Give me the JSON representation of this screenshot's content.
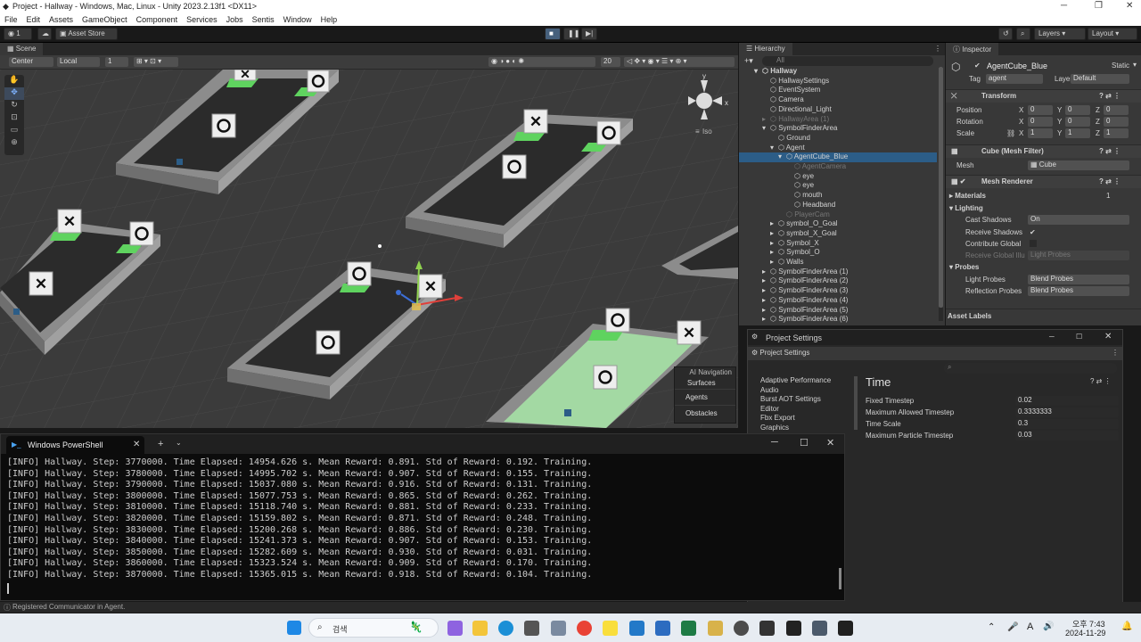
{
  "title": "Project - Hallway - Windows, Mac, Linux - Unity 2023.2.13f1 <DX11>",
  "menu": [
    "File",
    "Edit",
    "Assets",
    "GameObject",
    "Component",
    "Services",
    "Jobs",
    "Sentis",
    "Window",
    "Help"
  ],
  "toolbar": {
    "account": "1",
    "asset_store": "Asset Store",
    "layers": "Layers",
    "layout": "Layout"
  },
  "scene": {
    "tab": "Scene",
    "pivot": "Center",
    "space": "Local",
    "snap": "1",
    "zoom": "20",
    "iso": "Iso",
    "ai_nav": {
      "title": "AI Navigation",
      "items": [
        "Surfaces",
        "Agents",
        "Obstacles"
      ]
    }
  },
  "hierarchy": {
    "tab": "Hierarchy",
    "search": "All",
    "items": [
      {
        "label": "Hallway",
        "d": 0,
        "bold": true,
        "fold": "v"
      },
      {
        "label": "HallwaySettings",
        "d": 1
      },
      {
        "label": "EventSystem",
        "d": 1
      },
      {
        "label": "Camera",
        "d": 1
      },
      {
        "label": "Directional_Light",
        "d": 1
      },
      {
        "label": "HallwayArea (1)",
        "d": 1,
        "dim": true,
        "fold": ">"
      },
      {
        "label": "SymbolFinderArea",
        "d": 1,
        "fold": "v"
      },
      {
        "label": "Ground",
        "d": 2
      },
      {
        "label": "Agent",
        "d": 2,
        "fold": "v"
      },
      {
        "label": "AgentCube_Blue",
        "d": 3,
        "sel": true,
        "fold": "v"
      },
      {
        "label": "AgentCamera",
        "d": 4,
        "dim": true
      },
      {
        "label": "eye",
        "d": 4
      },
      {
        "label": "eye",
        "d": 4
      },
      {
        "label": "mouth",
        "d": 4
      },
      {
        "label": "Headband",
        "d": 4
      },
      {
        "label": "PlayerCam",
        "d": 3,
        "dim": true
      },
      {
        "label": "symbol_O_Goal",
        "d": 2,
        "fold": ">"
      },
      {
        "label": "symbol_X_Goal",
        "d": 2,
        "fold": ">"
      },
      {
        "label": "Symbol_X",
        "d": 2,
        "fold": ">"
      },
      {
        "label": "Symbol_O",
        "d": 2,
        "fold": ">"
      },
      {
        "label": "Walls",
        "d": 2,
        "fold": ">"
      },
      {
        "label": "SymbolFinderArea (1)",
        "d": 1,
        "fold": ">"
      },
      {
        "label": "SymbolFinderArea (2)",
        "d": 1,
        "fold": ">"
      },
      {
        "label": "SymbolFinderArea (3)",
        "d": 1,
        "fold": ">"
      },
      {
        "label": "SymbolFinderArea (4)",
        "d": 1,
        "fold": ">"
      },
      {
        "label": "SymbolFinderArea (5)",
        "d": 1,
        "fold": ">"
      },
      {
        "label": "SymbolFinderArea (6)",
        "d": 1,
        "fold": ">"
      }
    ]
  },
  "inspector": {
    "tab": "Inspector",
    "object": "AgentCube_Blue",
    "static": "Static",
    "tag_label": "Tag",
    "tag": "agent",
    "layer_label": "Layer",
    "layer": "Default",
    "transform": {
      "header": "Transform",
      "position": "Position",
      "rotation": "Rotation",
      "scale": "Scale",
      "pos": [
        "0",
        "0",
        "0"
      ],
      "rot": [
        "0",
        "0",
        "0"
      ],
      "scl": [
        "1",
        "1",
        "1"
      ]
    },
    "mesh_filter": {
      "header": "Cube (Mesh Filter)",
      "mesh_label": "Mesh",
      "mesh": "Cube"
    },
    "mesh_renderer": {
      "header": "Mesh Renderer",
      "materials": "Materials",
      "materials_count": "1",
      "lighting": "Lighting",
      "cast_shadows": "Cast Shadows",
      "cast_shadows_val": "On",
      "receive_shadows": "Receive Shadows",
      "contribute_gi": "Contribute Global",
      "receive_gi": "Receive Global Illu",
      "receive_gi_val": "Light Probes",
      "probes": "Probes",
      "light_probes": "Light Probes",
      "light_probes_val": "Blend Probes",
      "refl_probes": "Reflection Probes",
      "refl_probes_val": "Blend Probes"
    },
    "asset_labels": "Asset Labels"
  },
  "project_settings": {
    "window_title": "Project Settings",
    "tab": "Project Settings",
    "nav": [
      "Adaptive Performance",
      "Audio",
      "Burst AOT Settings",
      "Editor",
      "Fbx Export",
      "Graphics"
    ],
    "section": "Time",
    "rows": [
      [
        "Fixed Timestep",
        "0.02"
      ],
      [
        "Maximum Allowed Timestep",
        "0.3333333"
      ],
      [
        "Time Scale",
        "0.3"
      ],
      [
        "Maximum Particle Timestep",
        "0.03"
      ]
    ]
  },
  "powershell": {
    "tab": "Windows PowerShell",
    "lines": [
      "[INFO] Hallway. Step: 3770000. Time Elapsed: 14954.626 s. Mean Reward: 0.891. Std of Reward: 0.192. Training.",
      "[INFO] Hallway. Step: 3780000. Time Elapsed: 14995.702 s. Mean Reward: 0.907. Std of Reward: 0.155. Training.",
      "[INFO] Hallway. Step: 3790000. Time Elapsed: 15037.080 s. Mean Reward: 0.916. Std of Reward: 0.131. Training.",
      "[INFO] Hallway. Step: 3800000. Time Elapsed: 15077.753 s. Mean Reward: 0.865. Std of Reward: 0.262. Training.",
      "[INFO] Hallway. Step: 3810000. Time Elapsed: 15118.740 s. Mean Reward: 0.881. Std of Reward: 0.233. Training.",
      "[INFO] Hallway. Step: 3820000. Time Elapsed: 15159.802 s. Mean Reward: 0.871. Std of Reward: 0.248. Training.",
      "[INFO] Hallway. Step: 3830000. Time Elapsed: 15200.268 s. Mean Reward: 0.886. Std of Reward: 0.230. Training.",
      "[INFO] Hallway. Step: 3840000. Time Elapsed: 15241.373 s. Mean Reward: 0.907. Std of Reward: 0.153. Training.",
      "[INFO] Hallway. Step: 3850000. Time Elapsed: 15282.609 s. Mean Reward: 0.930. Std of Reward: 0.031. Training.",
      "[INFO] Hallway. Step: 3860000. Time Elapsed: 15323.524 s. Mean Reward: 0.909. Std of Reward: 0.170. Training.",
      "[INFO] Hallway. Step: 3870000. Time Elapsed: 15365.015 s. Mean Reward: 0.918. Std of Reward: 0.104. Training."
    ]
  },
  "status": "Registered Communicator in Agent.",
  "taskbar": {
    "search": "검색",
    "time": "오후 7:43",
    "date": "2024-11-29"
  },
  "colors": {
    "goal": "#5fd35f",
    "green_floor": "#a3d9a3",
    "accent": "#2c5d87"
  }
}
